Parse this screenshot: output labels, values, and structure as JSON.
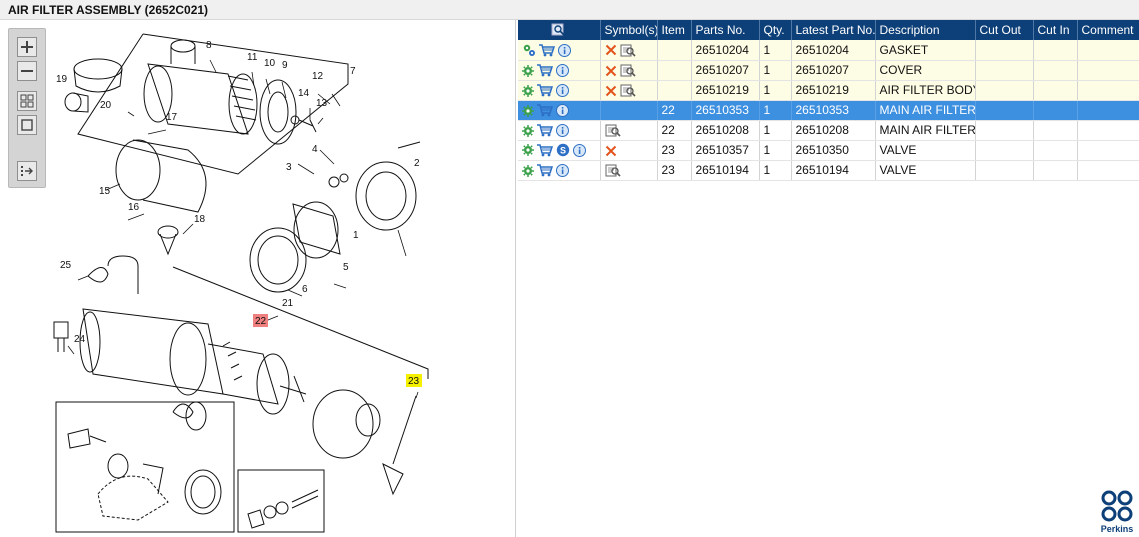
{
  "title": "AIR FILTER ASSEMBLY (2652C021)",
  "toolbar": {
    "buttons": [
      {
        "name": "zoom-in-button",
        "icon": "plus-icon"
      },
      {
        "name": "zoom-out-button",
        "icon": "minus-icon"
      },
      {
        "name": "fit-view-button",
        "icon": "grid-icon"
      },
      {
        "name": "window-button",
        "icon": "square-icon"
      },
      {
        "name": "export-button",
        "icon": "export-icon"
      }
    ]
  },
  "diagram": {
    "callouts": [
      "1",
      "2",
      "3",
      "4",
      "5",
      "6",
      "7",
      "8",
      "9",
      "10",
      "11",
      "12",
      "13",
      "14",
      "15",
      "16",
      "17",
      "18",
      "19",
      "20",
      "21",
      "22",
      "23",
      "24",
      "25"
    ],
    "highlight_red": "22",
    "highlight_yellow": "23",
    "colors": {
      "red_tag": "#f08080",
      "yellow_tag": "#f5f000"
    }
  },
  "grid": {
    "columns": [
      "",
      "Symbol(s)",
      "Item",
      "Parts No.",
      "Qty.",
      "Latest Part No.",
      "Description",
      "Cut Out",
      "Cut In",
      "Comment"
    ],
    "rows": [
      {
        "item": "",
        "part_no": "26510204",
        "qty": "1",
        "latest": "26510204",
        "desc": "GASKET",
        "state": "yellow",
        "symbols": [
          "cross-icon",
          "book-icon"
        ],
        "actions": [
          "gears-icon",
          "cart-icon",
          "info-icon"
        ]
      },
      {
        "item": "",
        "part_no": "26510207",
        "qty": "1",
        "latest": "26510207",
        "desc": "COVER",
        "state": "yellow",
        "symbols": [
          "cross-icon",
          "book-icon"
        ],
        "actions": [
          "gear-icon",
          "cart-icon",
          "info-icon"
        ]
      },
      {
        "item": "",
        "part_no": "26510219",
        "qty": "1",
        "latest": "26510219",
        "desc": "AIR FILTER BODY",
        "state": "yellow",
        "symbols": [
          "cross-icon",
          "book-icon"
        ],
        "actions": [
          "gear-icon",
          "cart-icon",
          "info-icon"
        ]
      },
      {
        "item": "22",
        "part_no": "26510353",
        "qty": "1",
        "latest": "26510353",
        "desc": "MAIN AIR FILTER",
        "state": "selected",
        "symbols": [],
        "actions": [
          "gear-icon",
          "cart-icon",
          "info-icon"
        ]
      },
      {
        "item": "22",
        "part_no": "26510208",
        "qty": "1",
        "latest": "26510208",
        "desc": "MAIN AIR FILTER",
        "state": "white",
        "symbols": [
          "book-icon"
        ],
        "actions": [
          "gear-icon",
          "cart-icon",
          "info-icon"
        ]
      },
      {
        "item": "23",
        "part_no": "26510357",
        "qty": "1",
        "latest": "26510350",
        "desc": "VALVE",
        "state": "white",
        "symbols": [
          "cross-icon"
        ],
        "actions": [
          "gear-icon",
          "cart-icon",
          "s-icon",
          "info-icon"
        ]
      },
      {
        "item": "23",
        "part_no": "26510194",
        "qty": "1",
        "latest": "26510194",
        "desc": "VALVE",
        "state": "white",
        "symbols": [
          "book-icon"
        ],
        "actions": [
          "gear-icon",
          "cart-icon",
          "info-icon"
        ]
      }
    ]
  },
  "brand": {
    "name": "Perkins",
    "color": "#0d3f78"
  }
}
